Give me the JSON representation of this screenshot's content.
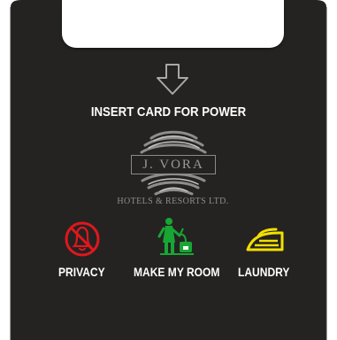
{
  "card_panel": {
    "instruction": "INSERT CARD FOR POWER",
    "brand": {
      "name": "J. VORA",
      "company": "HOTELS & RESORTS LTD."
    },
    "controls": [
      {
        "label": "PRIVACY",
        "icon": "do-not-disturb-bell-icon",
        "color": "#e0171d"
      },
      {
        "label": "MAKE MY ROOM",
        "icon": "housekeeping-vacuum-icon",
        "color": "#19a533"
      },
      {
        "label": "LAUNDRY",
        "icon": "iron-icon",
        "color": "#f2df00"
      }
    ],
    "colors": {
      "panel": "#242322",
      "slot": "#ffffff",
      "text": "#ffffff"
    }
  }
}
